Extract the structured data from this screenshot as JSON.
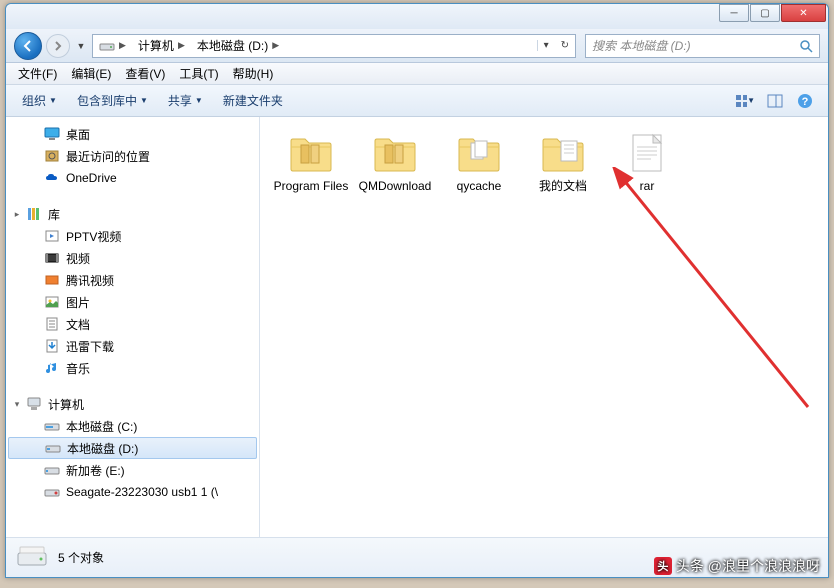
{
  "titlebar": {
    "min": "─",
    "max": "▢",
    "close": "✕"
  },
  "nav": {
    "breadcrumb": [
      {
        "icon": "computer",
        "label": "计算机"
      },
      {
        "icon": "",
        "label": "本地磁盘 (D:)"
      }
    ],
    "search_placeholder": "搜索 本地磁盘 (D:)"
  },
  "menu": [
    "文件(F)",
    "编辑(E)",
    "查看(V)",
    "工具(T)",
    "帮助(H)"
  ],
  "toolbar": {
    "organize": "组织",
    "include": "包含到库中",
    "share": "共享",
    "new_folder": "新建文件夹"
  },
  "sidebar": {
    "groups": [
      {
        "items": [
          {
            "icon": "desktop",
            "label": "桌面"
          },
          {
            "icon": "recent",
            "label": "最近访问的位置"
          },
          {
            "icon": "onedrive",
            "label": "OneDrive"
          }
        ]
      },
      {
        "header": {
          "icon": "library",
          "label": "库",
          "expand": "▸"
        },
        "items": [
          {
            "icon": "video",
            "label": "PPTV视频"
          },
          {
            "icon": "video2",
            "label": "视频"
          },
          {
            "icon": "tencent",
            "label": "腾讯视频"
          },
          {
            "icon": "pictures",
            "label": "图片"
          },
          {
            "icon": "docs",
            "label": "文档"
          },
          {
            "icon": "xunlei",
            "label": "迅雷下载"
          },
          {
            "icon": "music",
            "label": "音乐"
          }
        ]
      },
      {
        "header": {
          "icon": "computer",
          "label": "计算机",
          "expand": "▾"
        },
        "items": [
          {
            "icon": "drive",
            "label": "本地磁盘 (C:)"
          },
          {
            "icon": "drive",
            "label": "本地磁盘 (D:)",
            "selected": true
          },
          {
            "icon": "drive",
            "label": "新加卷 (E:)"
          },
          {
            "icon": "usb",
            "label": "Seagate-23223030 usb1 1 (\\"
          }
        ]
      }
    ]
  },
  "files": [
    {
      "type": "folder-open",
      "label": "Program Files"
    },
    {
      "type": "folder-open",
      "label": "QMDownload"
    },
    {
      "type": "folder-files",
      "label": "qycache"
    },
    {
      "type": "folder-doc",
      "label": "我的文档"
    },
    {
      "type": "textfile",
      "label": "rar"
    }
  ],
  "status": {
    "count": "5 个对象"
  },
  "watermark": "头条 @浪里个浪浪浪呀"
}
